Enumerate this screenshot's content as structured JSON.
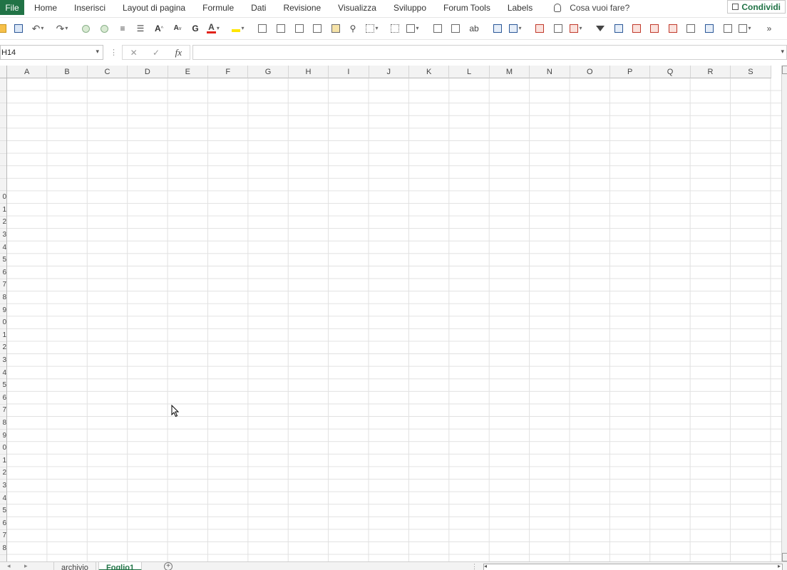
{
  "ribbon": {
    "file_tab": "File",
    "tabs": [
      "Home",
      "Inserisci",
      "Layout di pagina",
      "Formule",
      "Dati",
      "Revisione",
      "Visualizza",
      "Sviluppo",
      "Forum Tools",
      "Labels"
    ],
    "tell_me": "Cosa vuoi fare?",
    "share_button": "Condividi"
  },
  "toolbar": {
    "icons": [
      "open-icon",
      "save-icon",
      "undo-icon",
      "redo-icon",
      "circle-icon",
      "circle-icon",
      "align-center-icon",
      "justify-icon",
      "font-grow-icon",
      "font-shrink-icon",
      "bold-icon",
      "font-color-icon",
      "fill-color-icon",
      "format-painter-icon",
      "clear-format-icon",
      "number-format-icon",
      "paste-special-icon",
      "brush-icon",
      "find-icon",
      "borders-icon",
      "merge-icon",
      "table-icon",
      "grid-icon",
      "wrap-icon",
      "insert-icon",
      "shapes-icon",
      "check-icon",
      "copy-icon",
      "conditional-icon",
      "filter-icon",
      "sort-icon",
      "pivot-icon",
      "chart-icon",
      "calendar-icon",
      "find-replace-icon",
      "form-icon",
      "sparkline-icon",
      "more-icon",
      "overflow-icon"
    ],
    "font_color_label": "A",
    "grow_label": "A",
    "shrink_label": "A",
    "bold_label": "G"
  },
  "formula_bar": {
    "name_box": "H14",
    "fx_label": "fx",
    "cancel_label": "✕",
    "enter_label": "✓",
    "formula_value": ""
  },
  "grid": {
    "columns": [
      "A",
      "B",
      "C",
      "D",
      "E",
      "F",
      "G",
      "H",
      "I",
      "J",
      "K",
      "L",
      "M",
      "N",
      "O",
      "P",
      "Q",
      "R",
      "S"
    ],
    "row_labels": [
      "",
      "",
      "",
      "",
      "",
      "",
      "",
      "",
      "",
      "0",
      "1",
      "2",
      "3",
      "4",
      "5",
      "6",
      "7",
      "8",
      "9",
      "0",
      "1",
      "2",
      "3",
      "4",
      "5",
      "6",
      "7",
      "8",
      "9",
      "0",
      "1",
      "2",
      "3",
      "4",
      "5",
      "6",
      "7",
      "8"
    ],
    "selected_cell": "H14"
  },
  "sheets": {
    "tabs": [
      "archivio",
      "Foglio1"
    ],
    "active": "Foglio1"
  },
  "colors": {
    "brand_green": "#217346",
    "gridline": "#e1e1e1",
    "header_bg": "#f3f3f3"
  }
}
